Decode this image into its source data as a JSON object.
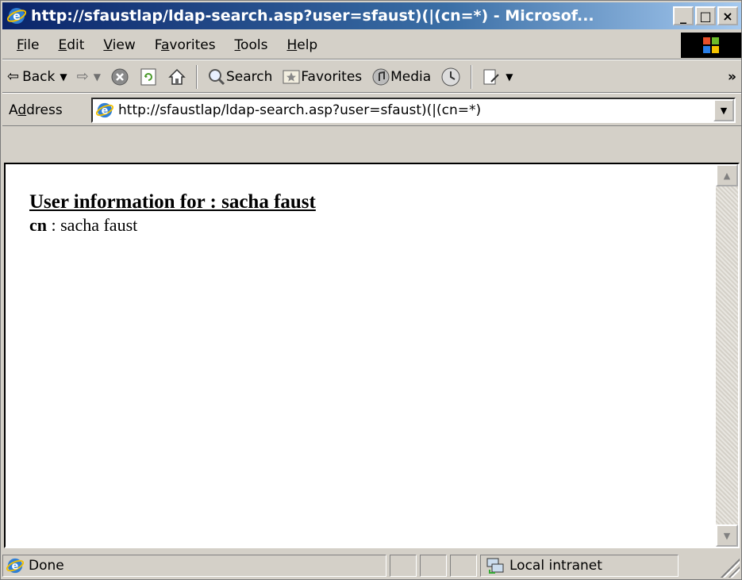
{
  "window": {
    "title": "http://sfaustlap/ldap-search.asp?user=sfaust)(|(cn=*) - Microsof..."
  },
  "menu": {
    "items": [
      {
        "pre": "",
        "accel": "F",
        "post": "ile"
      },
      {
        "pre": "",
        "accel": "E",
        "post": "dit"
      },
      {
        "pre": "",
        "accel": "V",
        "post": "iew"
      },
      {
        "pre": "F",
        "accel": "a",
        "post": "vorites"
      },
      {
        "pre": "",
        "accel": "T",
        "post": "ools"
      },
      {
        "pre": "",
        "accel": "H",
        "post": "elp"
      }
    ]
  },
  "toolbar": {
    "back_label": "Back",
    "search_label": "Search",
    "favorites_label": "Favorites",
    "media_label": "Media",
    "more_glyph": "»"
  },
  "address": {
    "label_pre": "A",
    "label_accel": "d",
    "label_post": "dress",
    "url": "http://sfaustlap/ldap-search.asp?user=sfaust)(|(cn=*)"
  },
  "page": {
    "heading": "User information for : sacha faust",
    "field_name": "cn",
    "field_sep": " : ",
    "field_value": "sacha faust"
  },
  "status": {
    "text": "Done",
    "zone": "Local intranet"
  },
  "colors": {
    "title_gradient_start": "#0a246a",
    "title_gradient_end": "#a6caf0",
    "chrome": "#d4d0c8"
  }
}
